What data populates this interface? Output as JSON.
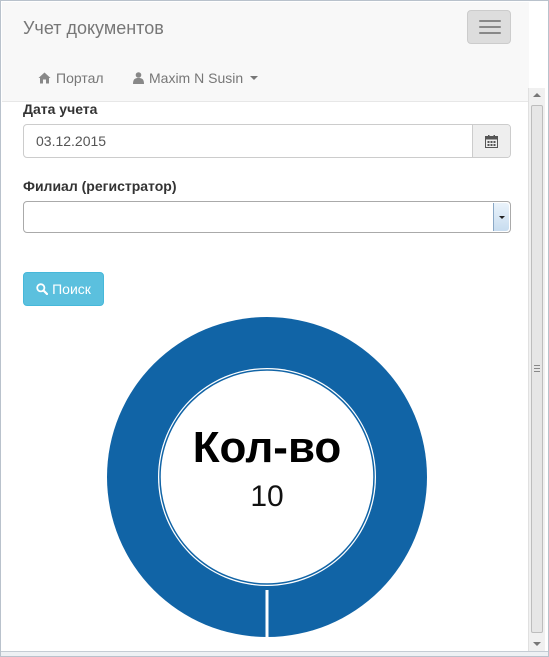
{
  "header": {
    "brand": "Учет документов",
    "nav": {
      "portal_label": "Портал",
      "portal_icon": "home-icon",
      "user_label": "Maxim N Susin",
      "user_icon": "user-icon"
    }
  },
  "form": {
    "date_label": "Дата учета",
    "date_value": "03.12.2015",
    "date_icon": "calendar-icon",
    "branch_label": "Филиал (регистратор)",
    "branch_value": "",
    "search_button": "Поиск",
    "search_icon": "search-icon"
  },
  "chart_data": {
    "type": "pie",
    "center_label": "Кол-во",
    "center_value": "10",
    "slices": [
      {
        "value": 10,
        "color": "#1164a6"
      }
    ]
  },
  "colors": {
    "donut": "#1164a6",
    "search_button": "#5bc0de"
  }
}
